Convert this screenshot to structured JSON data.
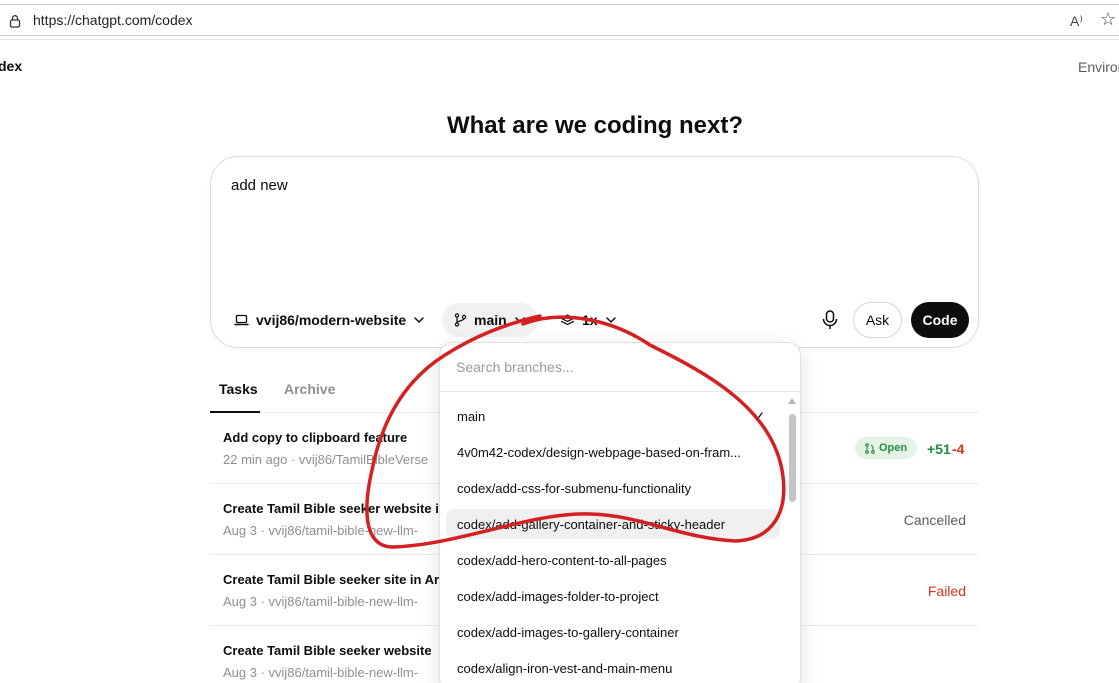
{
  "browser": {
    "url": "https://chatgpt.com/codex",
    "read_aloud_label": "A⁾",
    "favorite_glyph": "☆"
  },
  "app": {
    "title": "dex",
    "environments_link": "Environ"
  },
  "main": {
    "heading": "What are we coding next?"
  },
  "composer": {
    "prompt_text": "add new",
    "repo": "vvij86/modern-website",
    "branch": "main",
    "versions": "1x",
    "ask_label": "Ask",
    "code_label": "Code"
  },
  "tabs": [
    {
      "label": "Tasks",
      "active": true
    },
    {
      "label": "Archive",
      "active": false
    }
  ],
  "tasks": [
    {
      "title": "Add copy to clipboard feature",
      "meta": "22 min ago · vvij86/TamilBibleVerse",
      "status": "",
      "badge": "Open",
      "additions": "+51",
      "deletions": "-4"
    },
    {
      "title": "Create Tamil Bible seeker website i",
      "meta": "Aug 3 · vvij86/tamil-bible-new-llm-",
      "status": "Cancelled"
    },
    {
      "title": "Create Tamil Bible seeker site in Ar",
      "meta": "Aug 3 · vvij86/tamil-bible-new-llm-",
      "status": "Failed"
    },
    {
      "title": "Create Tamil Bible seeker website",
      "meta": "Aug 3 · vvij86/tamil-bible-new-llm-",
      "status": ""
    }
  ],
  "branch_dropdown": {
    "search_placeholder": "Search branches...",
    "selected": "main",
    "items": [
      "main",
      "4v0m42-codex/design-webpage-based-on-fram...",
      "codex/add-css-for-submenu-functionality",
      "codex/add-gallery-container-and-sticky-header",
      "codex/add-hero-content-to-all-pages",
      "codex/add-images-folder-to-project",
      "codex/add-images-to-gallery-container",
      "codex/align-iron-vest-and-main-menu"
    ],
    "hovered_index": 3
  },
  "colors": {
    "accent_dark": "#0d0d0d",
    "open_badge_bg": "#e3f3e6",
    "open_badge_text": "#2a8c3f",
    "additions": "#1e8e3e",
    "failed": "#d93025",
    "annotation_red": "#d42020"
  },
  "icons": {
    "lock": "lock-icon",
    "laptop": "laptop-icon",
    "branch": "git-branch-icon",
    "layers": "layers-icon",
    "mic": "microphone-icon",
    "pull_request": "pull-request-icon",
    "check": "checkmark-icon"
  }
}
